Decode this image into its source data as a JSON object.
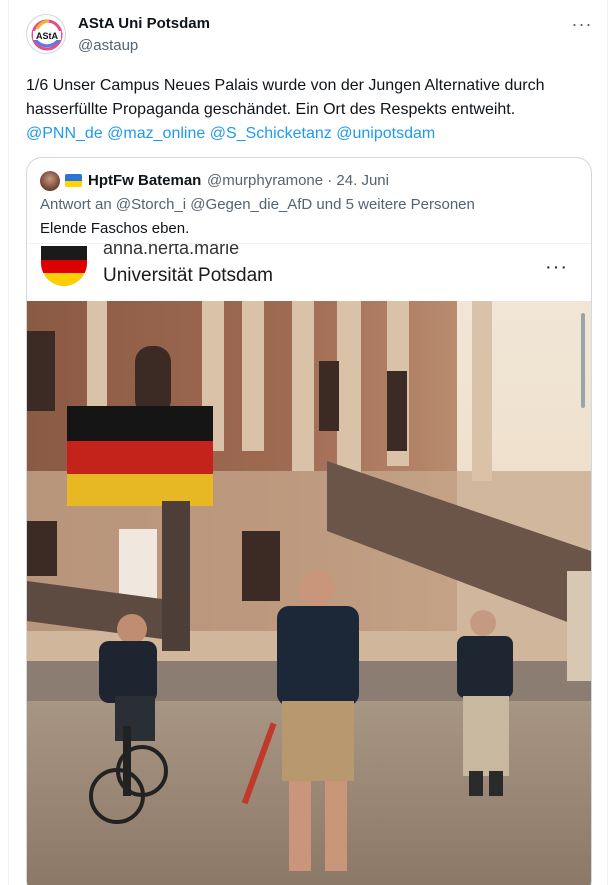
{
  "tweet": {
    "author_name": "AStA Uni Potsdam",
    "author_handle": "@astaup",
    "avatar_text": "AStA",
    "more_label": "···",
    "text_part1": "1/6 Unser Campus Neues Palais wurde von der Jungen Alternative durch hasserfüllte Propaganda geschändet. Ein Ort des Respekts entweiht.",
    "mentions": [
      "@PNN_de",
      "@maz_online",
      "@S_Schicketanz",
      "@unipotsdam"
    ]
  },
  "quote": {
    "name": "HptFw Bateman",
    "handle_date": "@murphyramone · 24. Juni",
    "reply_to": "Antwort an @Storch_i @Gegen_die_AfD und 5 weitere Personen",
    "text": "Elende Faschos eben.",
    "embed": {
      "username": "anna.herta.marie",
      "location": "Universität Potsdam",
      "more_label": "···"
    }
  },
  "colors": {
    "link": "#1d9bf0",
    "secondary_text": "#536471",
    "primary_text": "#0f1419"
  }
}
